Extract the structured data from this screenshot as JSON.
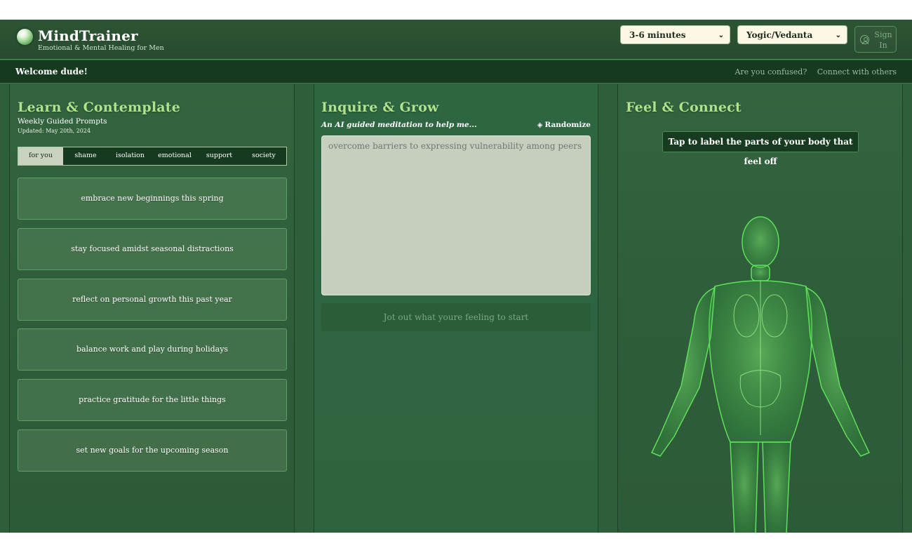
{
  "header": {
    "brand_title": "MindTrainer",
    "brand_subtitle": "Emotional & Mental Healing for Men",
    "duration_select": {
      "value": "3-6 minutes"
    },
    "tradition_select": {
      "value": "Yogic/Vedanta"
    },
    "signin_line1": "Sign",
    "signin_line2": "In"
  },
  "welcome": {
    "text": "Welcome dude!",
    "links": [
      "Are you confused?",
      "Connect with others"
    ]
  },
  "learn": {
    "title": "Learn & Contemplate",
    "subtitle": "Weekly Guided Prompts",
    "updated": "Updated: May 20th, 2024",
    "tabs": [
      {
        "label": "for you",
        "active": true
      },
      {
        "label": "shame",
        "active": false
      },
      {
        "label": "isolation",
        "active": false
      },
      {
        "label": "emotional",
        "active": false
      },
      {
        "label": "support",
        "active": false
      },
      {
        "label": "society",
        "active": false
      }
    ],
    "prompts": [
      "embrace new beginnings this spring",
      "stay focused amidst seasonal distractions",
      "reflect on personal growth this past year",
      "balance work and play during holidays",
      "practice gratitude for the little things",
      "set new goals for the upcoming season"
    ]
  },
  "inquire": {
    "title": "Inquire & Grow",
    "subtitle": "An AI guided meditation to help me...",
    "randomize_label": "Randomize",
    "input_placeholder": "overcome barriers to expressing vulnerability among peers",
    "input_value": "",
    "start_label": "Jot out what youre feeling to start"
  },
  "feel": {
    "title": "Feel & Connect",
    "tip": "Tap to label the parts of your body that feel off",
    "glow_color": "#45d04a"
  }
}
